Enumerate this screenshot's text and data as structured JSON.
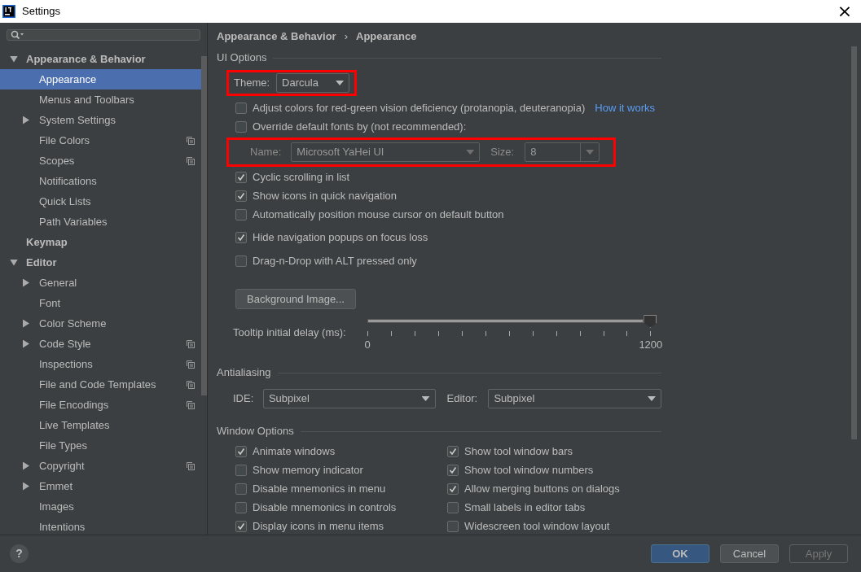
{
  "window": {
    "title": "Settings",
    "close": "×"
  },
  "sidebar": {
    "items": [
      {
        "label": "Appearance & Behavior",
        "bold": true,
        "expanded": true,
        "selected": false,
        "per_project": false,
        "children": [
          {
            "label": "Appearance",
            "selected": true,
            "per_project": false
          },
          {
            "label": "Menus and Toolbars",
            "selected": false,
            "per_project": false
          },
          {
            "label": "System Settings",
            "selected": false,
            "expanded": false,
            "per_project": false
          },
          {
            "label": "File Colors",
            "selected": false,
            "per_project": true
          },
          {
            "label": "Scopes",
            "selected": false,
            "per_project": true
          },
          {
            "label": "Notifications",
            "selected": false,
            "per_project": false
          },
          {
            "label": "Quick Lists",
            "selected": false,
            "per_project": false
          },
          {
            "label": "Path Variables",
            "selected": false,
            "per_project": false
          }
        ]
      },
      {
        "label": "Keymap",
        "bold": true,
        "selected": false,
        "per_project": false
      },
      {
        "label": "Editor",
        "bold": true,
        "expanded": true,
        "selected": false,
        "per_project": false,
        "children": [
          {
            "label": "General",
            "selected": false,
            "expanded": false,
            "per_project": false
          },
          {
            "label": "Font",
            "selected": false,
            "per_project": false
          },
          {
            "label": "Color Scheme",
            "selected": false,
            "expanded": false,
            "per_project": false
          },
          {
            "label": "Code Style",
            "selected": false,
            "expanded": false,
            "per_project": true
          },
          {
            "label": "Inspections",
            "selected": false,
            "per_project": true
          },
          {
            "label": "File and Code Templates",
            "selected": false,
            "per_project": true
          },
          {
            "label": "File Encodings",
            "selected": false,
            "per_project": true
          },
          {
            "label": "Live Templates",
            "selected": false,
            "per_project": false
          },
          {
            "label": "File Types",
            "selected": false,
            "per_project": false
          },
          {
            "label": "Copyright",
            "selected": false,
            "expanded": false,
            "per_project": true
          },
          {
            "label": "Emmet",
            "selected": false,
            "expanded": false,
            "per_project": false
          },
          {
            "label": "Images",
            "selected": false,
            "per_project": false
          },
          {
            "label": "Intentions",
            "selected": false,
            "per_project": false
          }
        ]
      }
    ]
  },
  "breadcrumb": [
    "Appearance & Behavior",
    "Appearance"
  ],
  "breadcrumb_separator": "›",
  "ui_options": {
    "title": "UI Options",
    "theme": {
      "label": "Theme:",
      "value": "Darcula",
      "highlighted": true
    },
    "checks_a": [
      {
        "label": "Adjust colors for red-green vision deficiency (protanopia, deuteranopia)",
        "checked": false,
        "link": "How it works"
      },
      {
        "label": "Override default fonts by (not recommended):",
        "checked": false
      }
    ],
    "font": {
      "highlighted": true,
      "disabled": true,
      "name_label": "Name:",
      "name_value": "Microsoft YaHei UI",
      "size_label": "Size:",
      "size_value": "8"
    },
    "checks_b": [
      {
        "label": "Cyclic scrolling in list",
        "checked": true
      },
      {
        "label": "Show icons in quick navigation",
        "checked": true
      },
      {
        "label": "Automatically position mouse cursor on default button",
        "checked": false
      },
      {
        "label": "Hide navigation popups on focus loss",
        "checked": true
      },
      {
        "label": "Drag-n-Drop with ALT pressed only",
        "checked": false
      }
    ],
    "background_button": "Background Image...",
    "tooltip": {
      "label": "Tooltip initial delay (ms):",
      "level": 1,
      "min": "0",
      "max": "1200"
    }
  },
  "antialiasing": {
    "title": "Antialiasing",
    "ide_label": "IDE:",
    "ide_value": "Subpixel",
    "editor_label": "Editor:",
    "editor_value": "Subpixel"
  },
  "window_options": {
    "title": "Window Options",
    "left": [
      {
        "label": "Animate windows",
        "checked": true
      },
      {
        "label": "Show memory indicator",
        "checked": false
      },
      {
        "label": "Disable mnemonics in menu",
        "checked": false
      },
      {
        "label": "Disable mnemonics in controls",
        "checked": false
      },
      {
        "label": "Display icons in menu items",
        "checked": true
      }
    ],
    "right": [
      {
        "label": "Show tool window bars",
        "checked": true
      },
      {
        "label": "Show tool window numbers",
        "checked": true
      },
      {
        "label": "Allow merging buttons on dialogs",
        "checked": true
      },
      {
        "label": "Small labels in editor tabs",
        "checked": false
      },
      {
        "label": "Widescreen tool window layout",
        "checked": false
      }
    ]
  },
  "footer": {
    "help": "?",
    "buttons": [
      {
        "label": "OK",
        "kind": "primary",
        "disabled": false
      },
      {
        "label": "Cancel",
        "kind": "normal",
        "disabled": false
      },
      {
        "label": "Apply",
        "kind": "normal",
        "disabled": true
      }
    ]
  }
}
